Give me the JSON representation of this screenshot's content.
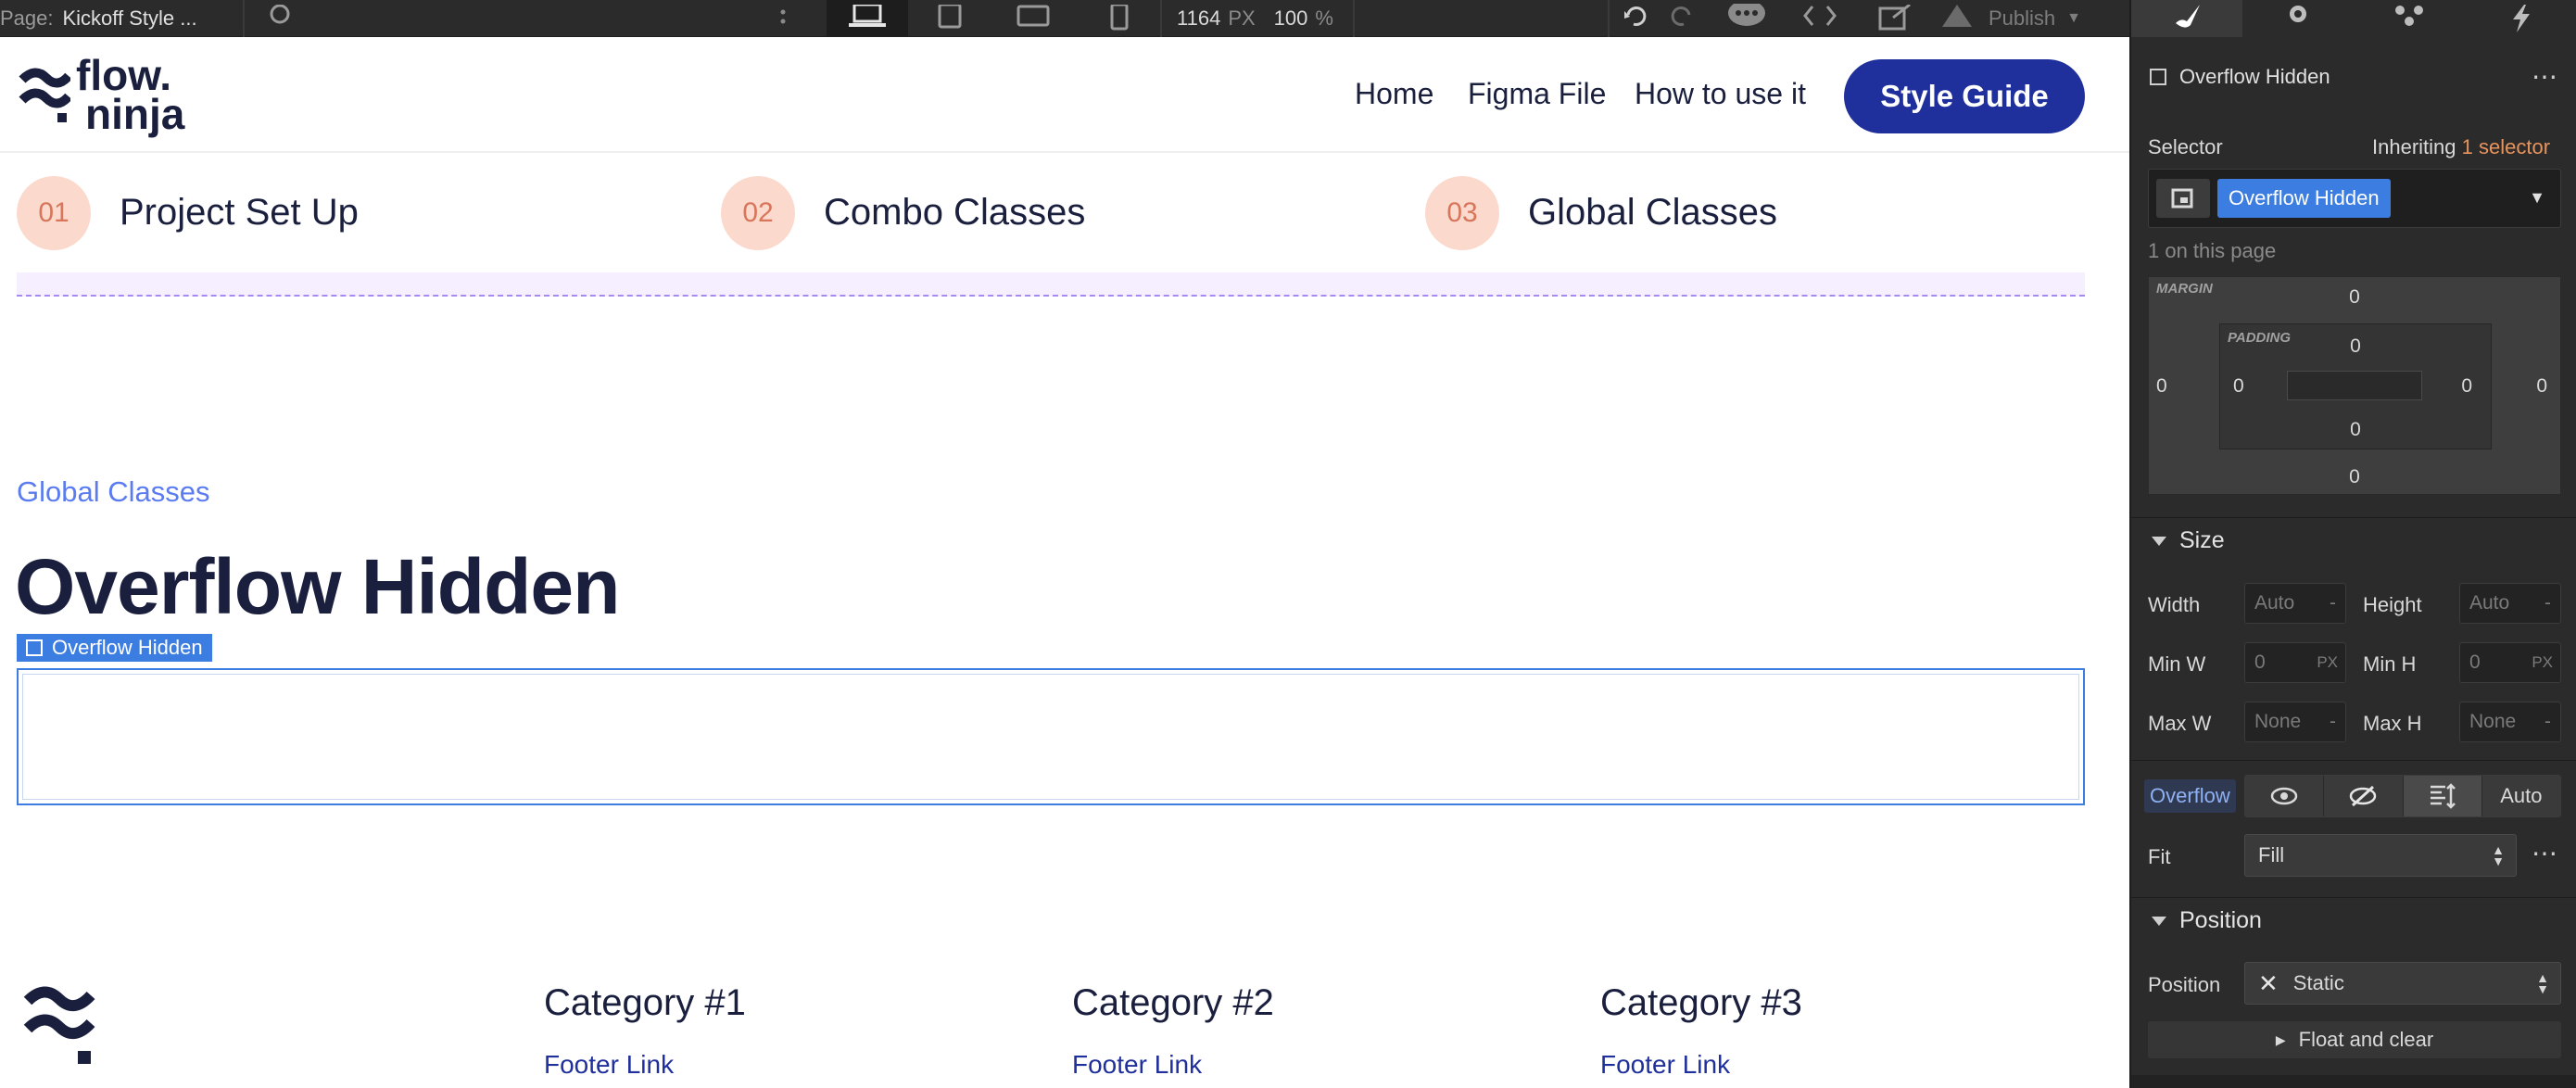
{
  "topbar": {
    "page_prefix": "Page:",
    "page_name": "Kickoff Style ...",
    "width_value": "1164",
    "width_unit": "PX",
    "zoom_value": "100",
    "zoom_unit": "%",
    "publish_label": "Publish"
  },
  "site": {
    "logo_line1": "flow.",
    "logo_line2": "ninja",
    "nav": [
      "Home",
      "Figma File",
      "How to use it"
    ],
    "cta": "Style Guide",
    "steps": [
      {
        "num": "01",
        "label": "Project Set Up"
      },
      {
        "num": "02",
        "label": "Combo Classes"
      },
      {
        "num": "03",
        "label": "Global Classes"
      }
    ],
    "eyebrow": "Global Classes",
    "heading": "Overflow Hidden",
    "selected_tag": "Overflow Hidden",
    "footer": {
      "categories": [
        "Category #1",
        "Category #2",
        "Category #3"
      ],
      "link": "Footer Link"
    }
  },
  "panel": {
    "element_name": "Overflow Hidden",
    "selector_label": "Selector",
    "inheriting_text": "Inheriting",
    "inheriting_count": "1 selector",
    "selector_chip": "Overflow Hidden",
    "on_page": "1 on this page",
    "margin_label": "MARGIN",
    "padding_label": "PADDING",
    "margin": {
      "top": "0",
      "right": "0",
      "bottom": "0",
      "left": "0"
    },
    "padding": {
      "top": "0",
      "right": "0",
      "bottom": "0",
      "left": "0"
    },
    "size_title": "Size",
    "width_label": "Width",
    "width_value": "Auto",
    "height_label": "Height",
    "height_value": "Auto",
    "minw_label": "Min W",
    "minw_value": "0",
    "minh_label": "Min H",
    "minh_value": "0",
    "px_unit": "PX",
    "dash": "-",
    "maxw_label": "Max W",
    "maxw_value": "None",
    "maxh_label": "Max H",
    "maxh_value": "None",
    "overflow_label": "Overflow",
    "overflow_auto": "Auto",
    "fit_label": "Fit",
    "fit_value": "Fill",
    "position_title": "Position",
    "position_label": "Position",
    "position_value": "Static",
    "float_label": "Float and clear"
  },
  "colors": {
    "brand_navy": "#1a1f3e",
    "cta_blue": "#1f2f9b",
    "selection_blue": "#3b7de0",
    "step_peach": "#fbd9cc",
    "inherit_orange": "#e8945c"
  }
}
